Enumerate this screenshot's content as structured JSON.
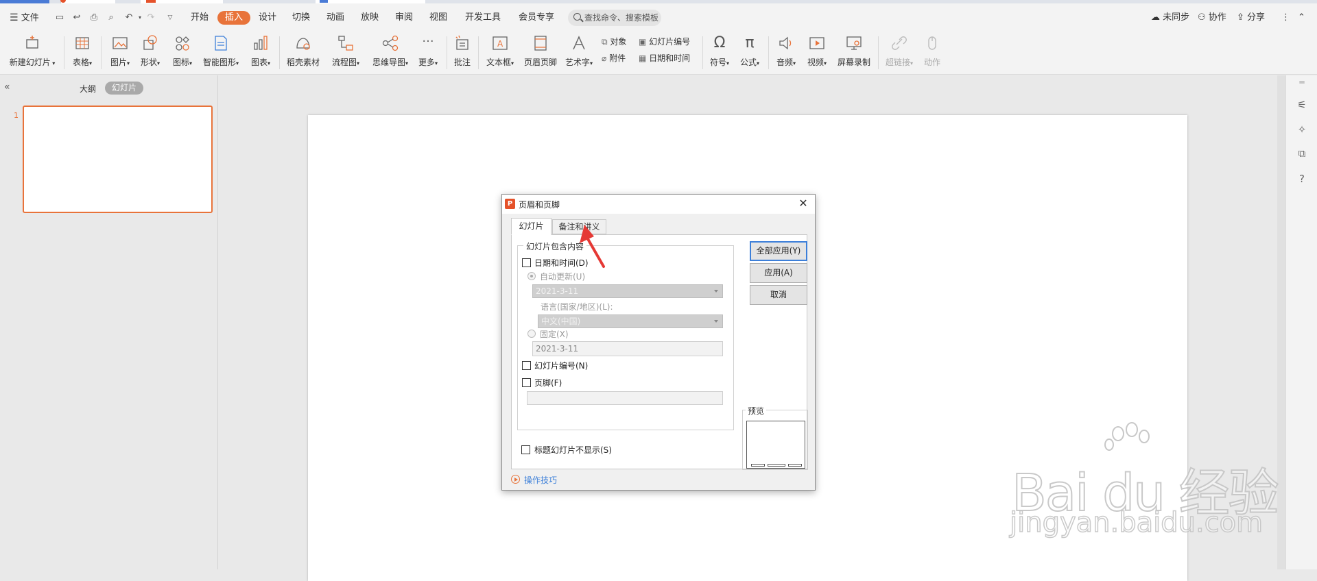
{
  "menu": {
    "file": "文件",
    "tabs": [
      "开始",
      "插入",
      "设计",
      "切换",
      "动画",
      "放映",
      "审阅",
      "视图",
      "开发工具",
      "会员专享"
    ],
    "active_tab": "插入",
    "search_placeholder": "查找命令、搜索模板",
    "right": {
      "sync": "未同步",
      "collab": "协作",
      "share": "分享"
    }
  },
  "ribbon": {
    "new_slide": "新建幻灯片",
    "table": "表格",
    "picture": "图片",
    "shape": "形状",
    "icon": "图标",
    "smart_graphic": "智能图形",
    "chart": "图表",
    "material": "稻壳素材",
    "flowchart": "流程图",
    "mindmap": "思维导图",
    "more": "更多",
    "comment": "批注",
    "textbox": "文本框",
    "header_footer": "页眉页脚",
    "wordart": "艺术字",
    "object": "对象",
    "attachment": "附件",
    "slide_number": "幻灯片编号",
    "date_time": "日期和时间",
    "symbol": "符号",
    "formula": "公式",
    "audio": "音频",
    "video": "视频",
    "screen_record": "屏幕录制",
    "hyperlink": "超链接",
    "action": "动作"
  },
  "left_panel": {
    "outline": "大纲",
    "slides": "幻灯片",
    "thumb_number": "1"
  },
  "dialog": {
    "title": "页眉和页脚",
    "tab_slide": "幻灯片",
    "tab_notes": "备注和讲义",
    "group_title": "幻灯片包含内容",
    "date_time": "日期和时间(D)",
    "auto_update": "自动更新(U)",
    "auto_date": "2021-3-11",
    "language_label": "语言(国家/地区)(L):",
    "language_value": "中文(中国)",
    "fixed": "固定(X)",
    "fixed_date": "2021-3-11",
    "slide_number": "幻灯片编号(N)",
    "footer": "页脚(F)",
    "hide_on_title": "标题幻灯片不显示(S)",
    "btn_apply_all": "全部应用(Y)",
    "btn_apply": "应用(A)",
    "btn_cancel": "取消",
    "preview": "预览",
    "tips": "操作技巧"
  },
  "watermark": {
    "brand": "Bai du 经验",
    "url": "jingyan.baidu.com"
  },
  "colors": {
    "accent_orange": "#e8733a",
    "link_blue": "#3c7fd9",
    "arrow_red": "#e53935"
  }
}
